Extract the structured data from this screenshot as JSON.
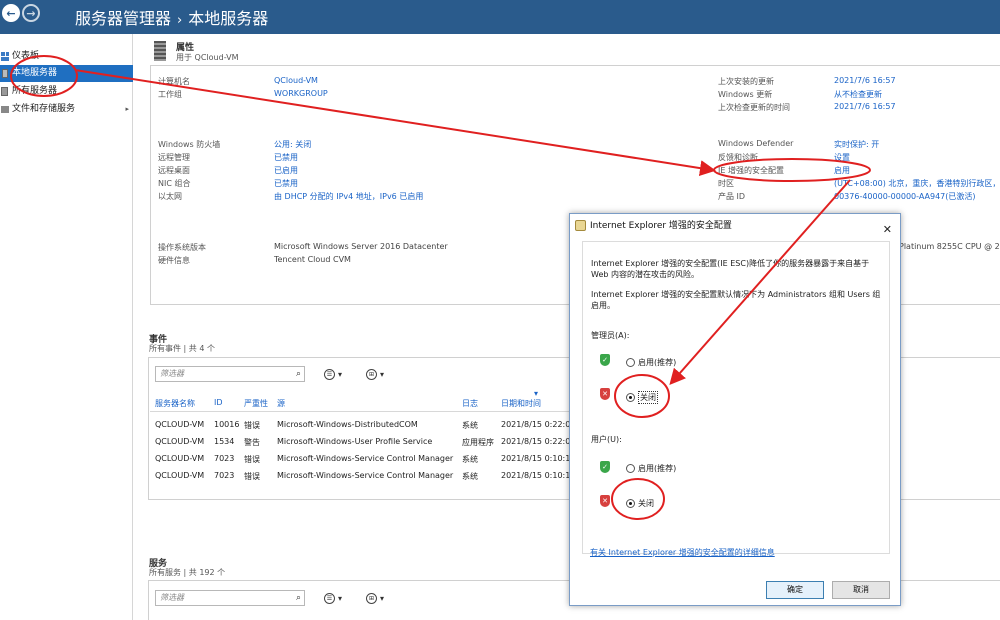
{
  "titlebar": {
    "back_icon": "back-arrow-icon",
    "forward_icon": "forward-arrow-icon",
    "app": "服务器管理器",
    "separator": "›",
    "page": "本地服务器"
  },
  "sidebar": {
    "items": [
      {
        "label": "仪表板",
        "icon": "dashboard-icon"
      },
      {
        "label": "本地服务器",
        "icon": "server-icon",
        "active": true
      },
      {
        "label": "所有服务器",
        "icon": "servers-icon"
      },
      {
        "label": "文件和存储服务",
        "icon": "files-icon",
        "expand_icon": "▸"
      }
    ]
  },
  "properties": {
    "title": "属性",
    "subtitle": "用于 QCloud-VM",
    "left_group1": [
      {
        "label": "计算机名",
        "value": "QCloud-VM"
      },
      {
        "label": "工作组",
        "value": "WORKGROUP"
      }
    ],
    "right_group1": [
      {
        "label": "上次安装的更新",
        "value": "2021/7/6 16:57"
      },
      {
        "label": "Windows 更新",
        "value": "从不检查更新"
      },
      {
        "label": "上次检查更新的时间",
        "value": "2021/7/6 16:57"
      }
    ],
    "left_group2": [
      {
        "label": "Windows 防火墙",
        "value": "公用: 关闭"
      },
      {
        "label": "远程管理",
        "value": "已禁用"
      },
      {
        "label": "远程桌面",
        "value": "已启用"
      },
      {
        "label": "NIC 组合",
        "value": "已禁用"
      },
      {
        "label": "以太网",
        "value": "由 DHCP 分配的 IPv4 地址，IPv6 已启用"
      }
    ],
    "right_group2": [
      {
        "label": "Windows Defender",
        "value": "实时保护: 开"
      },
      {
        "label": "反馈和诊断",
        "value": "设置"
      },
      {
        "label": "IE 增强的安全配置",
        "value": "启用"
      },
      {
        "label": "时区",
        "value": "(UTC+08:00) 北京，重庆，香港特别行政区，"
      },
      {
        "label": "产品 ID",
        "value": "00376-40000-00000-AA947(已激活)"
      }
    ],
    "left_group3": [
      {
        "label": "操作系统版本",
        "value": "Microsoft Windows Server 2016 Datacenter"
      },
      {
        "label": "硬件信息",
        "value": "Tencent Cloud CVM"
      }
    ],
    "cpu_partial": "Platinum 8255C CPU @ 2."
  },
  "events": {
    "title": "事件",
    "subtitle": "所有事件 | 共 4 个",
    "filter_placeholder": "筛选器",
    "search_icon": "⌕",
    "list_icon": "☰",
    "save_icon": "⊞",
    "dropdown": "▾",
    "sort_icon": "▾",
    "columns": [
      "服务器名称",
      "ID",
      "严重性",
      "源",
      "日志",
      "日期和时间"
    ],
    "rows": [
      [
        "QCLOUD-VM",
        "10016",
        "错误",
        "Microsoft-Windows-DistributedCOM",
        "系统",
        "2021/8/15 0:22:0"
      ],
      [
        "QCLOUD-VM",
        "1534",
        "警告",
        "Microsoft-Windows-User Profile Service",
        "应用程序",
        "2021/8/15 0:22:0"
      ],
      [
        "QCLOUD-VM",
        "7023",
        "错误",
        "Microsoft-Windows-Service Control Manager",
        "系统",
        "2021/8/15 0:10:1"
      ],
      [
        "QCLOUD-VM",
        "7023",
        "错误",
        "Microsoft-Windows-Service Control Manager",
        "系统",
        "2021/8/15 0:10:1"
      ]
    ]
  },
  "services": {
    "title": "服务",
    "subtitle": "所有服务 | 共 192 个",
    "filter_placeholder": "筛选器"
  },
  "dialog": {
    "title": "Internet Explorer 增强的安全配置",
    "close": "✕",
    "para1": "Internet Explorer 增强的安全配置(IE ESC)降低了你的服务器暴露于来自基于 Web 内容的潜在攻击的风险。",
    "para2": "Internet Explorer 增强的安全配置默认情况下为 Administrators 组和 Users 组启用。",
    "admin_label": "管理员(A):",
    "user_label": "用户(U):",
    "option_on": "启用(推荐)",
    "option_off": "关闭",
    "admin_selected": "off",
    "user_selected": "off",
    "shield_ok": "✓",
    "shield_bad": "✕",
    "link": "有关 Internet Explorer 增强的安全配置的详细信息",
    "ok": "确定",
    "cancel": "取消"
  },
  "colors": {
    "titlebar": "#2a5b8c",
    "link": "#1a63c7",
    "active": "#1f6fc1",
    "annotation": "#e02020"
  }
}
